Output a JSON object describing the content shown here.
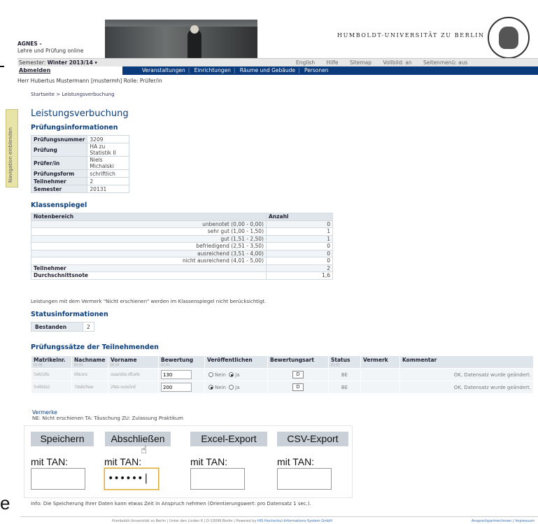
{
  "app": {
    "name": "AGNES -",
    "subtitle": "Lehre und Prüfung online",
    "university": "HUMBOLDT-UNIVERSITÄT ZU BERLIN"
  },
  "topbar": {
    "semester_label": "Semester:",
    "semester_value": "Winter 2013/14",
    "tools": [
      "English",
      "Hilfe",
      "Sitemap",
      "Vollbild: an",
      "Seitenmenü: aus"
    ]
  },
  "navbar": {
    "logout": "Abmelden",
    "items": [
      "Veranstaltungen",
      "Einrichtungen",
      "Räume und Gebäude",
      "Personen"
    ]
  },
  "user_line": "Herr Hubertus Mustermann [mustermh]   Rolle: Prüfer/in",
  "side_tab": "Navigation einblenden",
  "breadcrumb": "Startseite > Leistungsverbuchung",
  "page_title": "Leistungsverbuchung",
  "pruefungsinfo": {
    "heading": "Prüfungsinformationen",
    "rows": [
      {
        "k": "Prüfungsnummer",
        "v": "3209"
      },
      {
        "k": "Prüfung",
        "v": "HA zu Statistik II"
      },
      {
        "k": "Prüfer/in",
        "v": "Niels Michalski"
      },
      {
        "k": "Prüfungsform",
        "v": "schriftlich"
      },
      {
        "k": "Teilnehmer",
        "v": "2"
      },
      {
        "k": "Semester",
        "v": "20131"
      }
    ]
  },
  "klassenspiegel": {
    "heading": "Klassenspiegel",
    "col1": "Notenbereich",
    "col2": "Anzahl",
    "rows": [
      {
        "label": "unbenotet (0,00 - 0,00)",
        "n": "0"
      },
      {
        "label": "sehr gut (1,00 - 1,50)",
        "n": "1"
      },
      {
        "label": "gut (1,51 - 2,50)",
        "n": "1"
      },
      {
        "label": "befriedigend (2,51 - 3,50)",
        "n": "0"
      },
      {
        "label": "ausreichend (3,51 - 4,00)",
        "n": "0"
      },
      {
        "label": "nicht ausreichend (4,01 - 5,00)",
        "n": "0"
      }
    ],
    "teilnehmer_label": "Teilnehmer",
    "teilnehmer": "2",
    "durchschnitt_label": "Durchschnittsnote",
    "durchschnitt": "1,6"
  },
  "note_text": "Leistungen mit dem Vermerk \"Nicht erschienen\" werden im Klassenspiegel nicht berücksichtigt.",
  "statusinfo": {
    "heading": "Statusinformationen",
    "label": "Bestanden",
    "value": "2"
  },
  "pruefungssaetze": {
    "heading": "Prüfungssätze der Teilnehmenden",
    "cols": [
      "Matrikelnr.",
      "Nachname",
      "Vorname",
      "Bewertung",
      "Veröffentlichen",
      "Bewertungsart",
      "Status",
      "Vermerk",
      "Kommentar"
    ],
    "sort_hint": "(i) (i)",
    "radio_nein": "Nein",
    "radio_ja": "Ja",
    "rows": [
      {
        "matrikel": "5e6/1/6s",
        "nachname": "6Ncsns",
        "vorname": "ssas/sl/ss sfEarle",
        "bewertung": "130",
        "veroeffentlichen": "Ja",
        "art": "D",
        "status": "BE",
        "vermerk": "",
        "kommentar": "OK, Datensatz wurde geändert."
      },
      {
        "matrikel": "5v69/i/s2",
        "nachname": "7slsBcRaw",
        "vorname": "2Nss sv/ss5nE",
        "bewertung": "200",
        "veroeffentlichen": "Nein",
        "art": "D",
        "status": "BE",
        "vermerk": "",
        "kommentar": "OK, Datensatz wurde geändert."
      }
    ]
  },
  "vermerke": {
    "title": "Vermerke",
    "text": "NE: Nicht erschienen   TA: Täuschung   ZU: Zulassung Praktikum"
  },
  "actions": {
    "buttons": [
      "Speichern",
      "Abschließen",
      "Excel-Export",
      "CSV-Export"
    ],
    "tan_label": "mit TAN:",
    "tan_value_masked": "••••••|"
  },
  "edge_char": "e",
  "info_text": "Info: Die Speicherung Ihrer Daten kann etwas Zeit in Anspruch nehmen (Orientierungswert: pro Datensatz 1 sec.).",
  "footer": {
    "center": "Humboldt-Universität zu Berlin | Unter den Linden 6 | D-10099 Berlin | Powered by ",
    "powered": "HIS Hochschul-Informations-System GmbH",
    "right": "Ansprechpartner/innen | Impressum"
  }
}
